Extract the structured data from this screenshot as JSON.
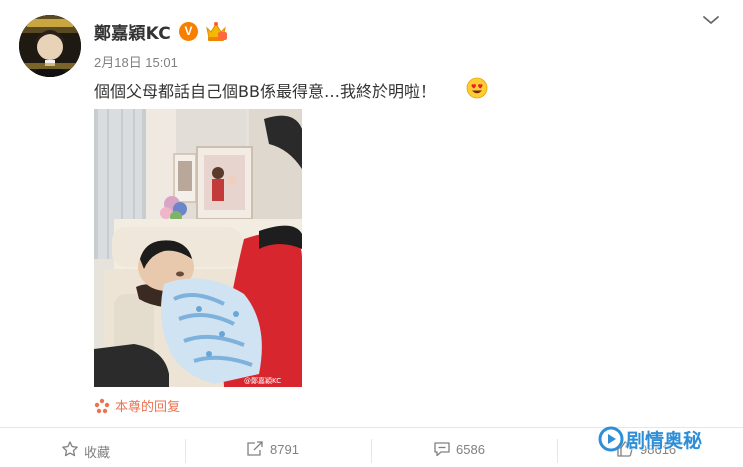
{
  "post": {
    "username": "鄭嘉穎KC",
    "verified_badge": "V",
    "timestamp": "2月18日 15:01",
    "text": "個個父母都話自己個BB係最得意…我終於明啦！",
    "emoji": "heart-eyes",
    "photo_watermark": "@鄭嘉穎KC",
    "copyright_label": "本尊的回复"
  },
  "actions": {
    "favorite_label": "收藏",
    "repost_count": "8791",
    "comment_count": "6586",
    "like_count": "98616"
  },
  "overlay": {
    "watermark_text": "剧情奥秘"
  },
  "colors": {
    "verified": "#f77f00",
    "copyright": "#eb7350",
    "watermark": "#2e8fd8",
    "muted": "#808080"
  }
}
